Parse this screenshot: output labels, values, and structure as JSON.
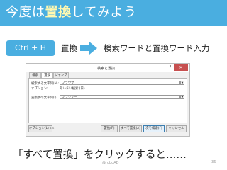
{
  "slide": {
    "title_pre": "今度は",
    "title_highlight": "置換",
    "title_post": "してみよう",
    "shortcut_key": "Ctrl + H",
    "step_from": "置換",
    "step_to": "検索ワードと置換ワード入力",
    "caption": "「すべて置換」をクリックすると……",
    "author": "@roboAD",
    "page_number": "36"
  },
  "dialog": {
    "title": "検索と置換",
    "help_glyph": "?",
    "close_glyph": "✕",
    "tabs": [
      {
        "label": "検索",
        "active": false
      },
      {
        "label": "置換",
        "active": true
      },
      {
        "label": "ジャンプ",
        "active": false
      }
    ],
    "find_label": "検索する文字列(N):",
    "find_value": "ブラウザ",
    "options_label": "オプション:",
    "options_value": "あいまい検索 (日)",
    "replace_label": "置換後の文字列(I):",
    "replace_value": "ブラウザー",
    "more_options_button": "オプション(L) >>",
    "replace_button": "置換(R)",
    "replace_all_button": "すべて置換(A)",
    "find_next_button": "次を検索(F)",
    "cancel_button": "キャンセル"
  },
  "colors": {
    "accent": "#4aaee0",
    "title_highlight": "#fff8b0",
    "close_button": "#c75050"
  }
}
